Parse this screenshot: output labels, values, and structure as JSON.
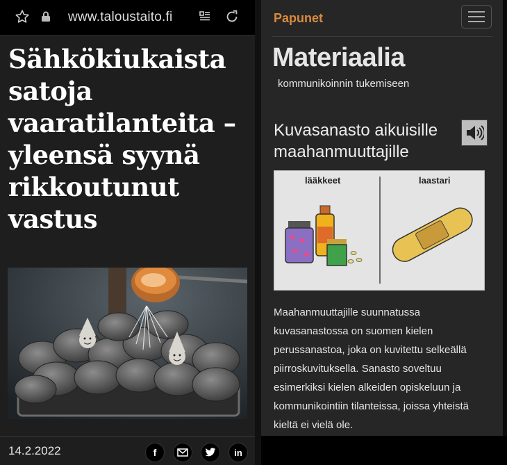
{
  "left_panel": {
    "url": "www.taloustaito.fi",
    "headline": "Sähkökiukaista satoja vaaratilanteita – yleensä syynä rikkoutunut vastus",
    "date": "14.2.2022",
    "icons": [
      "star-icon",
      "lock-icon",
      "reader-mode-icon",
      "reload-icon",
      "facebook-icon",
      "mail-icon",
      "twitter-icon",
      "linkedin-icon"
    ],
    "share": {
      "facebook": "f",
      "linkedin": "in"
    }
  },
  "right_panel": {
    "brand": "Papunet",
    "title": "Materiaalia",
    "subtitle": "kommunikoinnin tukemiseen",
    "card_title": "Kuvasanasto aikuisille maahanmuuttajille",
    "illustration": {
      "left_label": "lääkkeet",
      "right_label": "laastari"
    },
    "description": "Maahanmuuttajille suunnatussa kuvasanastossa on suomen kielen perussanastoa, joka on kuvitettu selkeällä piirroskuvituksella. Sanasto soveltuu esimerkiksi kielen alkeiden opiskeluun ja kommunikointiin tilanteissa, joissa yhteistä kieltä ei vielä ole.",
    "icons": [
      "menu-icon",
      "speaker-icon"
    ]
  },
  "colors": {
    "brand": "#d98a3d",
    "background_left": "#1e1e1e",
    "background_right": "#262626"
  }
}
